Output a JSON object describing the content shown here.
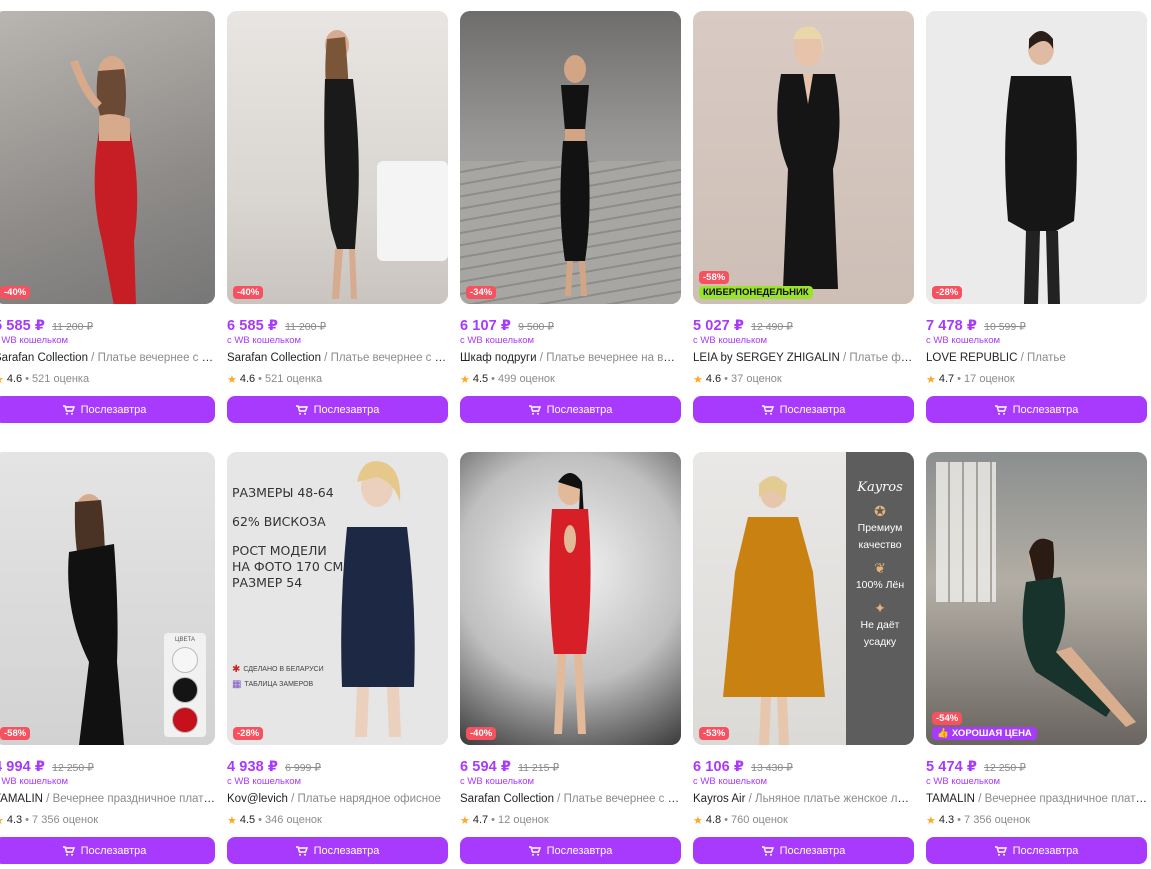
{
  "button_label": "Послезавтра",
  "wallet_label": "с WB кошельком",
  "products": [
    {
      "price": "5 585 ₽",
      "old_price": "11 200 ₽",
      "brand": "Sarafan Collection",
      "name": "Платье вечернее с открытой спиной",
      "rating": "4.6",
      "reviews": "521 оценка",
      "discount": "-40%",
      "promo": ""
    },
    {
      "price": "6 585 ₽",
      "old_price": "11 200 ₽",
      "brand": "Sarafan Collection",
      "name": "Платье вечернее с открытой спиной",
      "rating": "4.6",
      "reviews": "521 оценка",
      "discount": "-40%",
      "promo": ""
    },
    {
      "price": "6 107 ₽",
      "old_price": "9 500 ₽",
      "brand": "Шкаф подруги",
      "name": "Платье вечернее на выпускной",
      "rating": "4.5",
      "reviews": "499 оценок",
      "discount": "-34%",
      "promo": ""
    },
    {
      "price": "5 027 ₽",
      "old_price": "12 490 ₽",
      "brand": "LEIA by SERGEY ZHIGALIN",
      "name": "Платье футляр",
      "rating": "4.6",
      "reviews": "37 оценок",
      "discount": "-58%",
      "promo": "КИБЕРПОНЕДЕЛЬНИК"
    },
    {
      "price": "7 478 ₽",
      "old_price": "10 599 ₽",
      "brand": "LOVE REPUBLIC",
      "name": "Платье",
      "rating": "4.7",
      "reviews": "17 оценок",
      "discount": "-28%",
      "promo": ""
    },
    {
      "price": "4 994 ₽",
      "old_price": "12 250 ₽",
      "brand": "TAMALIN",
      "name": "Вечернее праздничное платье",
      "rating": "4.3",
      "reviews": "7 356 оценок",
      "discount": "-58%",
      "promo": ""
    },
    {
      "price": "4 938 ₽",
      "old_price": "6 999 ₽",
      "brand": "Kov@levich",
      "name": "Платье нарядное офисное",
      "rating": "4.5",
      "reviews": "346 оценок",
      "discount": "-28%",
      "promo": ""
    },
    {
      "price": "6 594 ₽",
      "old_price": "11 215 ₽",
      "brand": "Sarafan Collection",
      "name": "Платье вечернее с открытой спиной",
      "rating": "4.7",
      "reviews": "12 оценок",
      "discount": "-40%",
      "promo": ""
    },
    {
      "price": "6 106 ₽",
      "old_price": "13 430 ₽",
      "brand": "Kayros Air",
      "name": "Льняное платье женское летнее",
      "rating": "4.8",
      "reviews": "760 оценок",
      "discount": "-53%",
      "promo": ""
    },
    {
      "price": "5 474 ₽",
      "old_price": "12 250 ₽",
      "brand": "TAMALIN",
      "name": "Вечернее праздничное платье",
      "rating": "4.3",
      "reviews": "7 356 оценок",
      "discount": "-54%",
      "promo": "ХОРОШАЯ ЦЕНА"
    }
  ],
  "overlay_kov": {
    "l1": "РАЗМЕРЫ 48-64",
    "l2": "62% ВИСКОЗА",
    "l3": "РОСТ МОДЕЛИ",
    "l4": "НА ФОТО 170 СМ,",
    "l5": "РАЗМЕР 54",
    "made": "СДЕЛАНО В БЕЛАРУСИ",
    "table": "ТАБЛИЦА ЗАМЕРОВ"
  },
  "overlay_kayros": {
    "logo": "Kayros",
    "f1a": "Премиум",
    "f1b": "качество",
    "f2": "100% Лён",
    "f3a": "Не даёт",
    "f3b": "усадку"
  },
  "overlay_tamalin": {
    "label": "ЦВЕТА"
  },
  "colors": {
    "accent": "#a73afd",
    "discount": "#f5515f",
    "cyber": "#9be32b",
    "star": "#ffa726"
  }
}
